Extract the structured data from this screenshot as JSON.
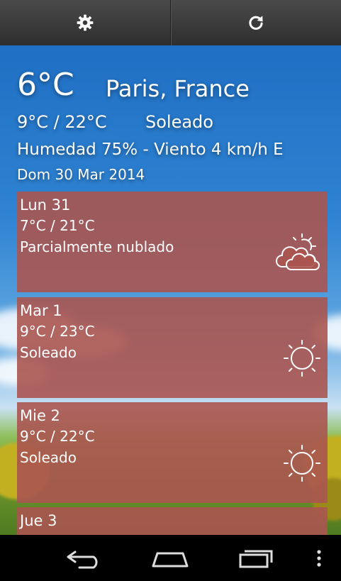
{
  "toolbar": {
    "left_icon": "gear-icon",
    "right_icon": "refresh-icon"
  },
  "current": {
    "temp": "6°C",
    "city": "Paris, France",
    "range": "9°C / 22°C",
    "condition": "Soleado",
    "humidity_wind": "Humedad 75% - Viento 4 km/h E",
    "date": "Dom 30 Mar 2014"
  },
  "forecast": [
    {
      "day": "Lun 31",
      "range": "7°C / 21°C",
      "condition": "Parcialmente nublado",
      "icon": "partly-cloudy-icon"
    },
    {
      "day": "Mar 1",
      "range": "9°C / 23°C",
      "condition": "Soleado",
      "icon": "sun-icon"
    },
    {
      "day": "Mie 2",
      "range": "9°C / 22°C",
      "condition": "Soleado",
      "icon": "sun-icon"
    },
    {
      "day": "Jue 3",
      "range": "",
      "condition": "",
      "icon": ""
    }
  ],
  "navbar": {
    "back": "back-icon",
    "home": "home-icon",
    "recents": "recents-icon",
    "menu": "overflow-menu-icon"
  }
}
